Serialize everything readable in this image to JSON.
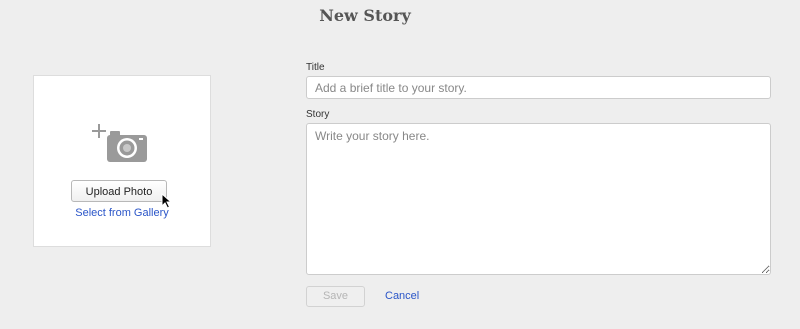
{
  "header": {
    "title": "New Story"
  },
  "photo_panel": {
    "icon": "add-photo-camera-icon",
    "upload_label": "Upload Photo",
    "gallery_label": "Select from Gallery"
  },
  "form": {
    "title_label": "Title",
    "title_placeholder": "Add a brief title to your story.",
    "title_value": "",
    "story_label": "Story",
    "story_placeholder": "Write your story here.",
    "story_value": "",
    "save_label": "Save",
    "save_enabled": false,
    "cancel_label": "Cancel"
  },
  "colors": {
    "background": "#eeeeee",
    "link": "#2a55c8",
    "disabled_text": "#b5b5b5"
  }
}
